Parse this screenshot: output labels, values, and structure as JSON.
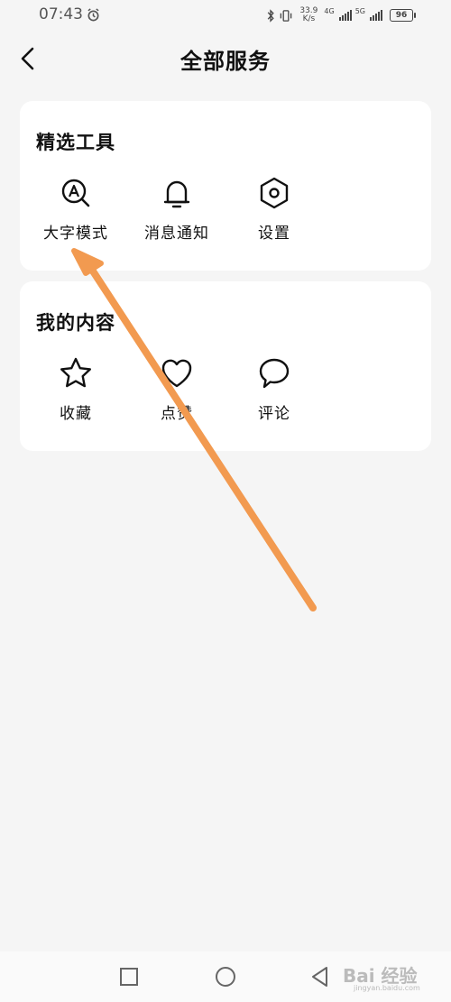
{
  "status_bar": {
    "time": "07:43",
    "speed_value": "33.9",
    "speed_unit": "K/s",
    "net_1": "4G",
    "net_2": "5G",
    "battery": "96"
  },
  "header": {
    "title": "全部服务"
  },
  "sections": [
    {
      "title": "精选工具",
      "items": [
        {
          "label": "大字模式",
          "icon": "large-font-icon"
        },
        {
          "label": "消息通知",
          "icon": "bell-icon"
        },
        {
          "label": "设置",
          "icon": "settings-icon"
        }
      ]
    },
    {
      "title": "我的内容",
      "items": [
        {
          "label": "收藏",
          "icon": "star-icon"
        },
        {
          "label": "点赞",
          "icon": "heart-icon"
        },
        {
          "label": "评论",
          "icon": "comment-icon"
        }
      ]
    }
  ],
  "watermark": {
    "text": "Bai 经验",
    "sub": "jingyan.baidu.com"
  },
  "colors": {
    "background": "#f5f5f5",
    "card": "#ffffff",
    "arrow": "#f29a50"
  }
}
